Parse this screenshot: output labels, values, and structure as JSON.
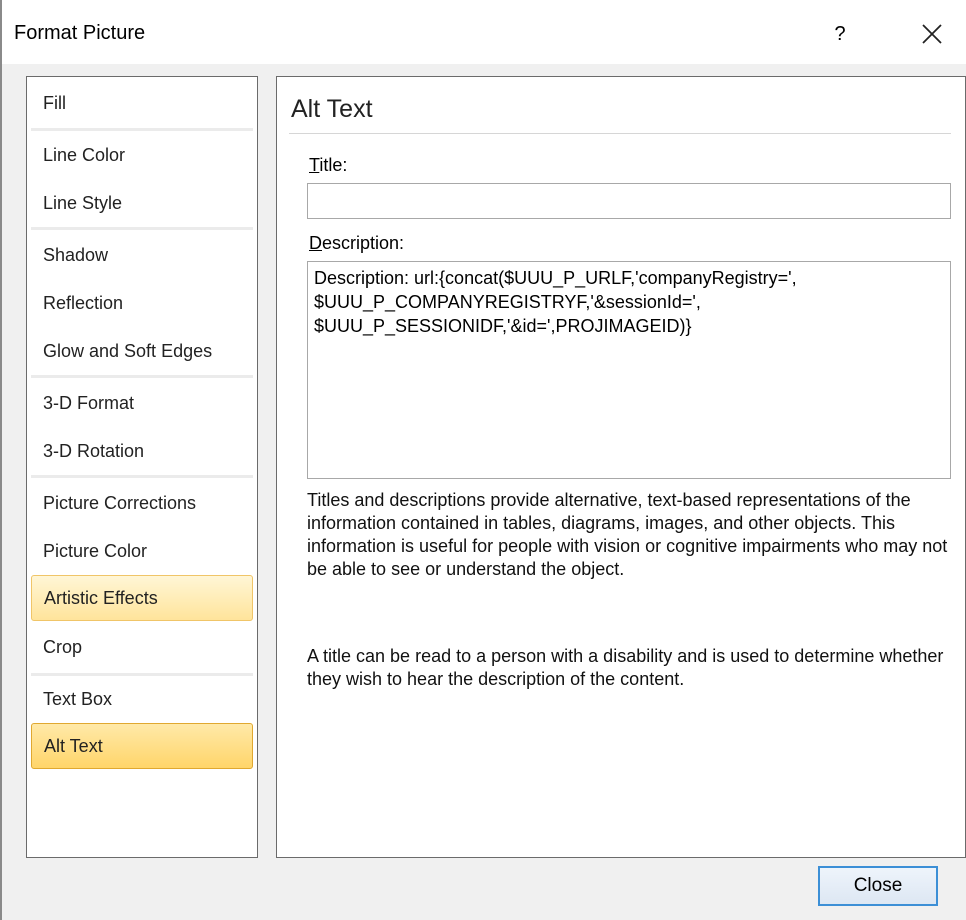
{
  "window": {
    "title": "Format Picture",
    "help_label": "?"
  },
  "nav": {
    "items": [
      {
        "label": "Fill"
      },
      {
        "label": "Line Color"
      },
      {
        "label": "Line Style"
      },
      {
        "label": "Shadow"
      },
      {
        "label": "Reflection"
      },
      {
        "label": "Glow and Soft Edges"
      },
      {
        "label": "3-D Format"
      },
      {
        "label": "3-D Rotation"
      },
      {
        "label": "Picture Corrections"
      },
      {
        "label": "Picture Color"
      },
      {
        "label": "Artistic Effects"
      },
      {
        "label": "Crop"
      },
      {
        "label": "Text Box"
      },
      {
        "label": "Alt Text"
      }
    ],
    "selected": "Alt Text",
    "hovered": "Artistic Effects"
  },
  "alt_text": {
    "heading": "Alt Text",
    "title_label_mnemonic": "T",
    "title_label_rest": "itle:",
    "title_value": "",
    "description_label_mnemonic": "D",
    "description_label_rest": "escription:",
    "description_value": "Description: url:{concat($UUU_P_URLF,'companyRegistry=',\n$UUU_P_COMPANYREGISTRYF,'&sessionId=',\n$UUU_P_SESSIONIDF,'&id=',PROJIMAGEID)}",
    "help_paragraph_1": "Titles and descriptions provide alternative, text-based representations of the information contained in tables, diagrams, images, and other objects. This information is useful for people with vision or cognitive impairments who may not be able to see or understand the object.",
    "help_paragraph_2": "A title can be read to a person with a disability and is used to determine whether they wish to hear the description of the content."
  },
  "footer": {
    "close_label": "Close"
  },
  "colors": {
    "selected_fill": "#ffd56a",
    "selected_border": "#e0a830",
    "default_button_border": "#3c8fd6"
  }
}
